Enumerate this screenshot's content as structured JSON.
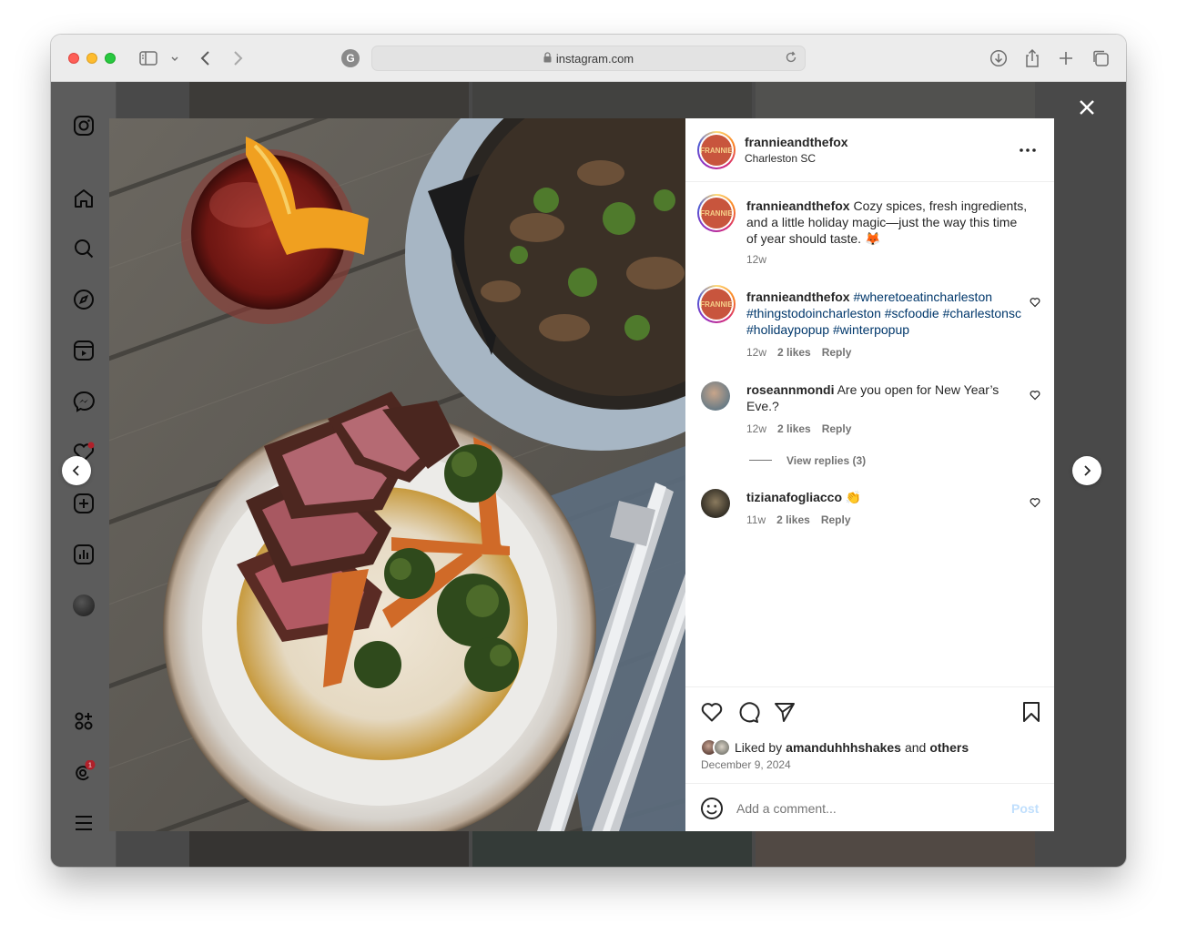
{
  "browser": {
    "url": "instagram.com",
    "favicon_letter": "G"
  },
  "post": {
    "author": "frannieandthefox",
    "location": "Charleston SC",
    "avatar_label": "FRANNIE",
    "caption": {
      "username": "frannieandthefox",
      "text": "Cozy spices, fresh ingredients, and a little holiday magic—just the way this time of year should taste. 🦊",
      "time": "12w"
    },
    "comments": [
      {
        "username": "frannieandthefox",
        "hashtags": "#wheretoeatincharleston #thingstodoincharleston #scfoodie #charlestonsc #holidaypopup #winterpopup",
        "time": "12w",
        "likes": "2 likes",
        "reply": "Reply"
      },
      {
        "username": "roseannmondi",
        "text": "Are you open for New Year’s Eve.?",
        "time": "12w",
        "likes": "2 likes",
        "reply": "Reply",
        "view_replies": "View replies (3)"
      },
      {
        "username": "tizianafogliacco",
        "text": "👏",
        "time": "11w",
        "likes": "2 likes",
        "reply": "Reply"
      }
    ],
    "liked_by_prefix": "Liked by",
    "liked_by_user": "amanduhhhshakes",
    "liked_by_and": "and",
    "liked_by_others": "others",
    "date": "December 9, 2024",
    "add_comment_placeholder": "Add a comment...",
    "post_button": "Post"
  },
  "sidebar": {
    "notification_count": "1"
  }
}
